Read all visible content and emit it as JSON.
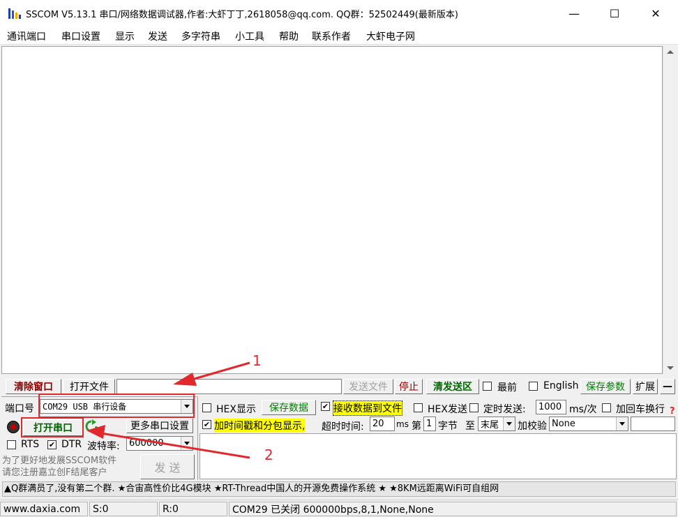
{
  "window": {
    "title": "SSCOM V5.13.1 串口/网络数据调试器,作者:大虾丁丁,2618058@qq.com. QQ群：52502449(最新版本)",
    "minimize_glyph": "—",
    "maximize_glyph": "☐",
    "close_glyph": "✕"
  },
  "menu": [
    "通讯端口",
    "串口设置",
    "显示",
    "发送",
    "多字符串",
    "小工具",
    "帮助",
    "联系作者",
    "大虾电子网"
  ],
  "toolbar": {
    "clear_window": "清除窗口",
    "open_file": "打开文件",
    "file_path": "",
    "send_file": "发送文件",
    "stop": "停止",
    "clear_send": "清发送区",
    "topmost": "最前",
    "english": "English",
    "save_params": "保存参数",
    "expand": "扩展",
    "collapse": "—"
  },
  "port": {
    "label": "端口号",
    "value": "COM29 USB 串行设备",
    "open_button": "打开串口",
    "more_settings": "更多串口设置",
    "rts_label": "RTS",
    "rts_checked": false,
    "dtr_label": "DTR",
    "dtr_checked": true,
    "baud_label": "波特率:",
    "baud_value": "600000"
  },
  "options": {
    "hex_display": "HEX显示",
    "hex_display_checked": false,
    "save_data": "保存数据",
    "recv_to_file": "接收数据到文件",
    "recv_to_file_checked": true,
    "hex_send": "HEX发送",
    "hex_send_checked": false,
    "timed_send": "定时发送:",
    "timed_send_checked": false,
    "interval_value": "1000",
    "interval_unit": "ms/次",
    "add_crlf": "加回车换行",
    "add_crlf_checked": false,
    "help_mark": "?",
    "timestamp": "加时间戳和分包显示,",
    "timestamp_checked": true,
    "timeout_label": "超时时间:",
    "timeout_value": "20",
    "timeout_unit": "ms",
    "byte_prefix": "第",
    "byte_value": "1",
    "byte_label": "字节",
    "to_label": "至",
    "end_value": "末尾",
    "checksum_label": "加校验",
    "checksum_value": "None"
  },
  "send": {
    "promo": "为了更好地发展SSCOM软件\n请您注册嘉立创F结尾客户",
    "button": "发 送",
    "input_value": ""
  },
  "ticker": "▲Q群满员了,没有第二个群. ★合宙高性价比4G模块 ★RT-Thread中国人的开源免费操作系统 ★ ★8KM远距离WiFi可自组网",
  "status": {
    "website": "www.daxia.com",
    "sent": "S:0",
    "received": "R:0",
    "port_status": "COM29 已关闭  600000bps,8,1,None,None"
  },
  "annotations": {
    "label_1": "1",
    "label_2": "2",
    "color": "#e0282d"
  },
  "colors": {
    "clear_window": "#8b0000",
    "clear_send": "#006400",
    "save_green": "#008000",
    "highlight_yellow": "#ffff00"
  }
}
